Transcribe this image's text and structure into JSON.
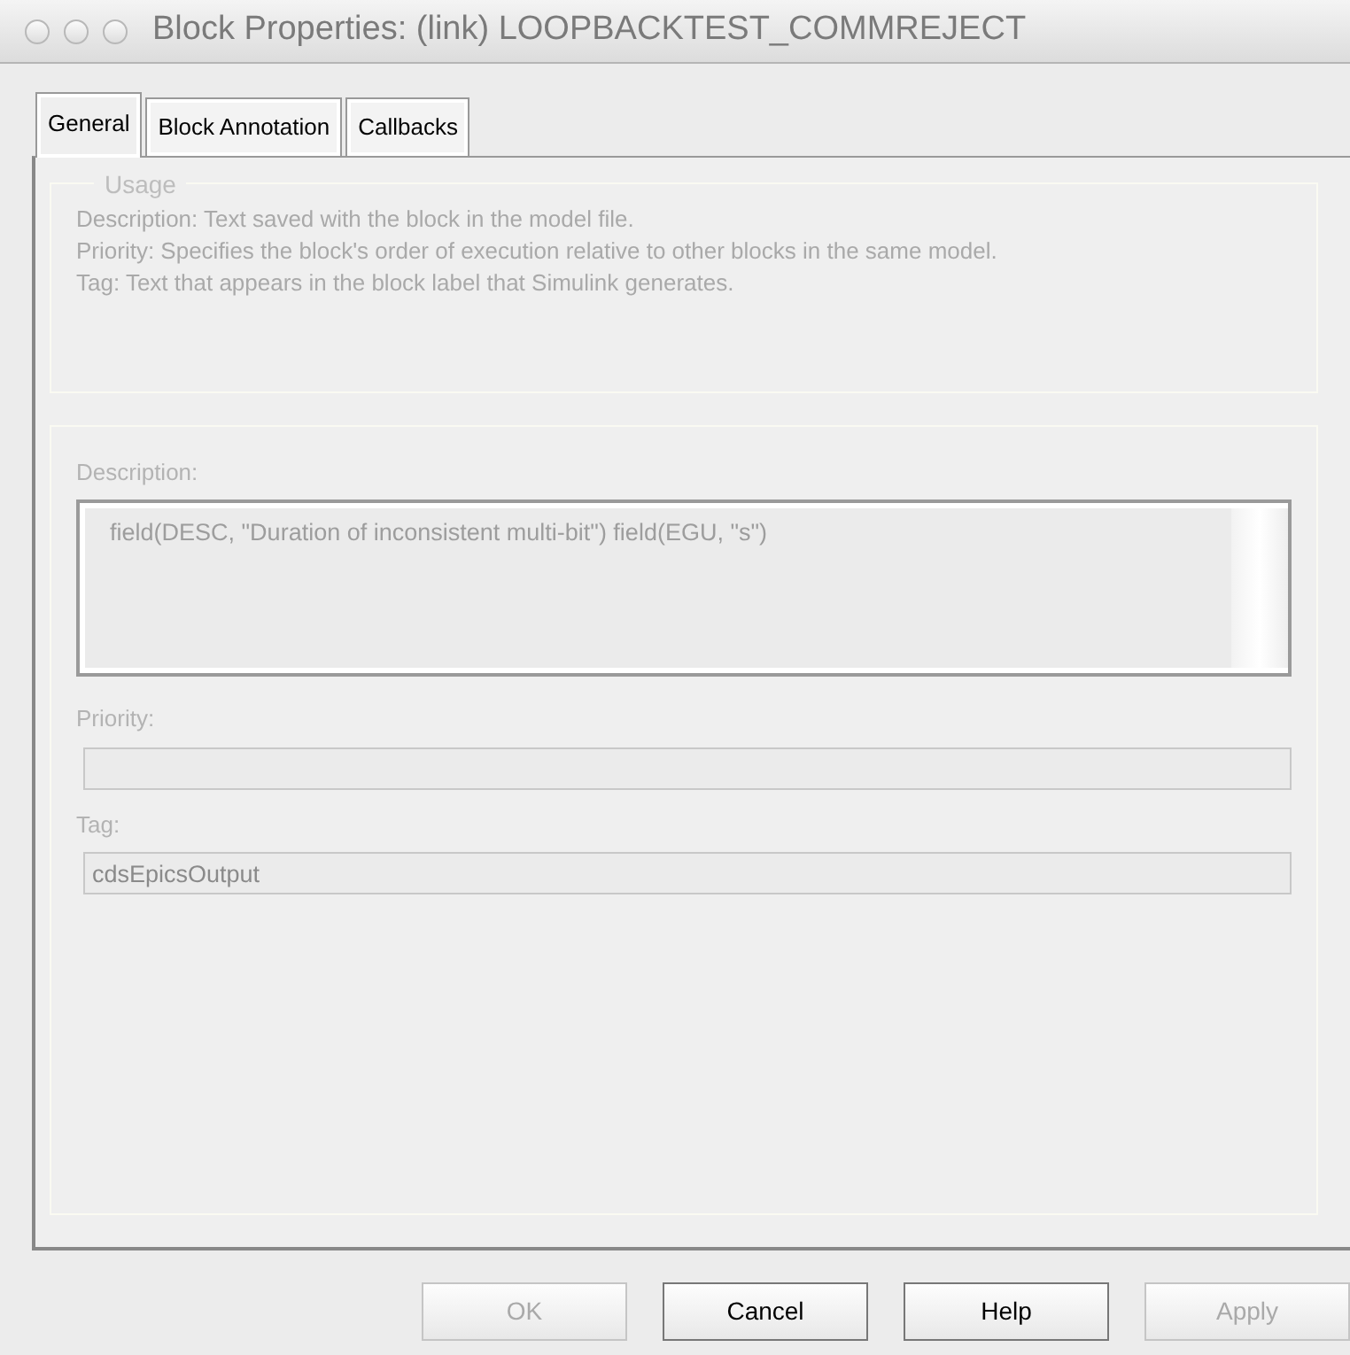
{
  "window": {
    "title": "Block Properties:  (link) LOOPBACKTEST_COMMREJECT"
  },
  "tabs": [
    {
      "label": "General",
      "selected": true
    },
    {
      "label": "Block Annotation",
      "selected": false
    },
    {
      "label": "Callbacks",
      "selected": false
    }
  ],
  "usage": {
    "title": "Usage",
    "lines": [
      "Description: Text saved with the block in the model file.",
      "Priority: Specifies the block's order of execution relative to other blocks in the same model.",
      "Tag: Text that appears in the block label that Simulink generates."
    ]
  },
  "fields": [
    {
      "kind": "textarea",
      "label": "Description:",
      "value": "field(DESC, \"Duration of inconsistent multi-bit\") field(EGU, \"s\")",
      "disabled": true
    },
    {
      "kind": "input",
      "label": "Priority:",
      "disabled": true
    },
    {
      "kind": "input",
      "label": "Tag:",
      "value": "cdsEpicsOutput",
      "disabled": true
    }
  ],
  "buttons": [
    {
      "label": "OK",
      "disabled": true
    },
    {
      "label": "Cancel",
      "disabled": false
    },
    {
      "label": "Help",
      "disabled": false
    },
    {
      "label": "Apply",
      "disabled": true
    }
  ]
}
